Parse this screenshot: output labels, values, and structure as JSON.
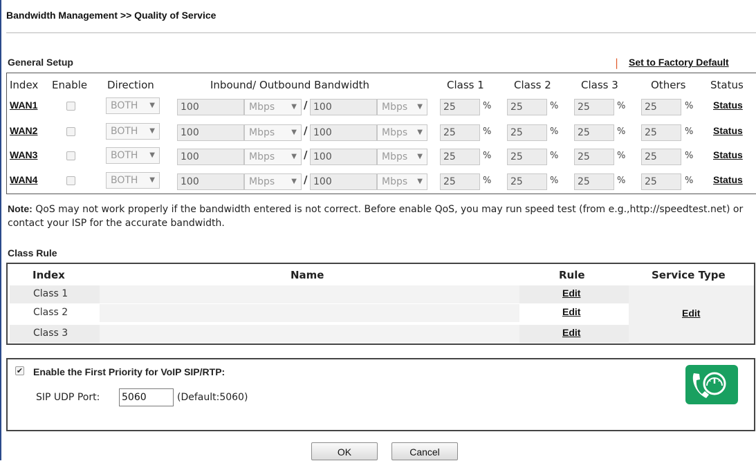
{
  "page": {
    "title": "Bandwidth Management >> Quality of Service"
  },
  "general_setup": {
    "title": "General Setup",
    "factory_sep": "|",
    "factory_default": "Set to Factory Default",
    "headers": {
      "index": "Index",
      "enable": "Enable",
      "direction": "Direction",
      "bandwidth": "Inbound/ Outbound Bandwidth",
      "class1": "Class 1",
      "class2": "Class 2",
      "class3": "Class 3",
      "others": "Others",
      "status": "Status"
    },
    "rows": [
      {
        "name": "WAN1",
        "enabled": false,
        "direction": "BOTH",
        "inbound": "100",
        "inbound_unit": "Mbps",
        "outbound": "100",
        "outbound_unit": "Mbps",
        "class1": "25",
        "class2": "25",
        "class3": "25",
        "others": "25",
        "status": "Status"
      },
      {
        "name": "WAN2",
        "enabled": false,
        "direction": "BOTH",
        "inbound": "100",
        "inbound_unit": "Mbps",
        "outbound": "100",
        "outbound_unit": "Mbps",
        "class1": "25",
        "class2": "25",
        "class3": "25",
        "others": "25",
        "status": "Status"
      },
      {
        "name": "WAN3",
        "enabled": false,
        "direction": "BOTH",
        "inbound": "100",
        "inbound_unit": "Mbps",
        "outbound": "100",
        "outbound_unit": "Mbps",
        "class1": "25",
        "class2": "25",
        "class3": "25",
        "others": "25",
        "status": "Status"
      },
      {
        "name": "WAN4",
        "enabled": false,
        "direction": "BOTH",
        "inbound": "100",
        "inbound_unit": "Mbps",
        "outbound": "100",
        "outbound_unit": "Mbps",
        "class1": "25",
        "class2": "25",
        "class3": "25",
        "others": "25",
        "status": "Status"
      }
    ],
    "pct": "%",
    "slash": "/"
  },
  "note": {
    "label": "Note:",
    "text": " QoS may not work properly if the bandwidth entered is not correct. Before enable QoS, you may run speed test (from e.g.,http://speedtest.net) or contact your ISP for the accurate bandwidth."
  },
  "class_rule": {
    "title": "Class Rule",
    "headers": {
      "index": "Index",
      "name": "Name",
      "rule": "Rule",
      "service_type": "Service Type"
    },
    "rows": [
      {
        "index": "Class 1",
        "name": "",
        "rule": "Edit"
      },
      {
        "index": "Class 2",
        "name": "",
        "rule": "Edit"
      },
      {
        "index": "Class 3",
        "name": "",
        "rule": "Edit"
      }
    ],
    "service_type_edit": "Edit"
  },
  "voip": {
    "checked": true,
    "label": "Enable the First Priority for VoIP SIP/RTP:",
    "sip_label": "SIP UDP Port:",
    "sip_value": "5060",
    "sip_default": "(Default:5060)",
    "icon": "voip-speedometer-phone-icon",
    "icon_color": "#19a060"
  },
  "buttons": {
    "ok": "OK",
    "cancel": "Cancel"
  }
}
